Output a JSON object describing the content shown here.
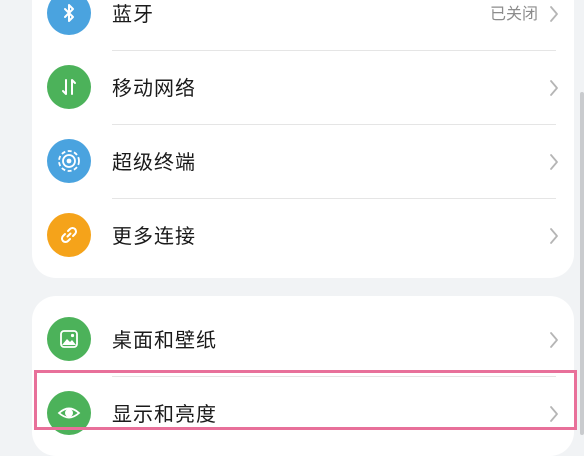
{
  "connections": {
    "items": [
      {
        "label": "蓝牙",
        "value": "已关闭",
        "icon": "bluetooth-icon",
        "color": "#4aa3df"
      },
      {
        "label": "移动网络",
        "value": "",
        "icon": "mobile-data-icon",
        "color": "#4cb25a"
      },
      {
        "label": "超级终端",
        "value": "",
        "icon": "super-device-icon",
        "color": "#4aa3df"
      },
      {
        "label": "更多连接",
        "value": "",
        "icon": "link-icon",
        "color": "#f5a31a"
      }
    ]
  },
  "display": {
    "items": [
      {
        "label": "桌面和壁纸",
        "icon": "wallpaper-icon",
        "color": "#4cb25a"
      },
      {
        "label": "显示和亮度",
        "icon": "eye-icon",
        "color": "#4cb25a"
      }
    ]
  },
  "colors": {
    "background": "#f1f3f5",
    "card": "#ffffff",
    "highlight": "#e8709a"
  }
}
